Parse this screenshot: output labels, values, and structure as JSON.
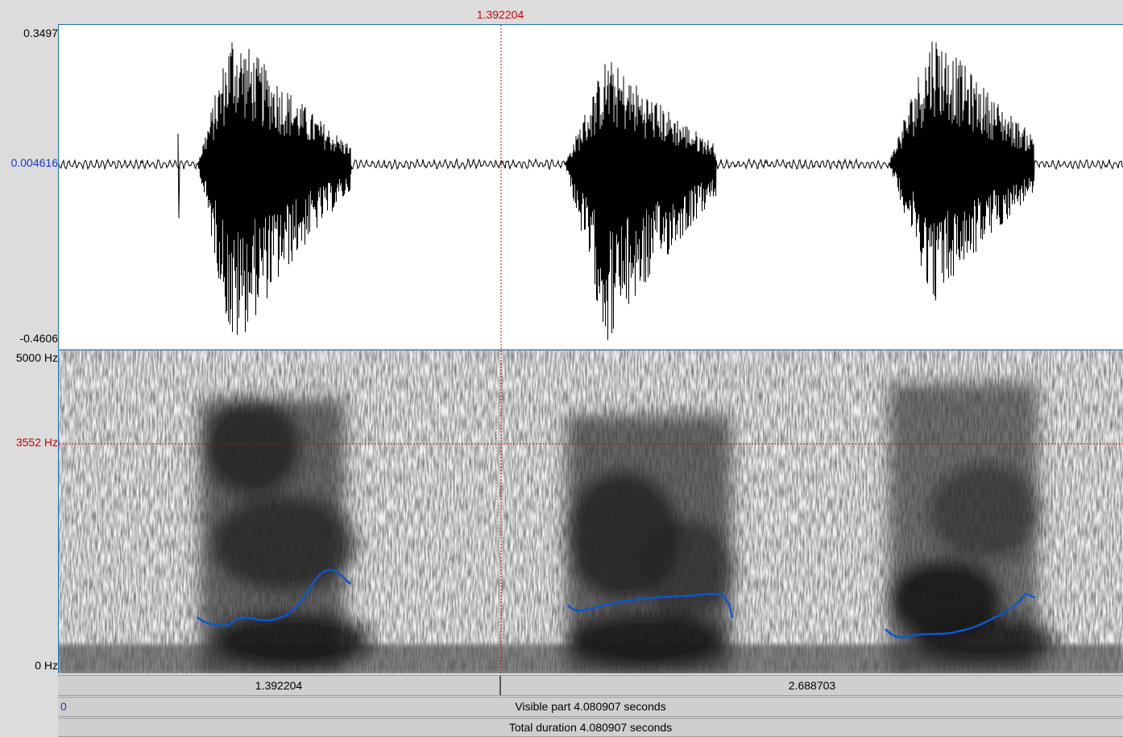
{
  "cursor": {
    "time_label": "1.392204",
    "time_seconds": 1.392204
  },
  "waveform": {
    "max_label": "0.3497",
    "mid_label": "0.004616",
    "min_label": "-0.4606",
    "color": "#000000"
  },
  "spectrogram": {
    "top_label": "5000 Hz",
    "cursor_label": "3552 Hz",
    "bottom_label": "0 Hz",
    "pitch_color": "#0b57d0"
  },
  "time_bar": {
    "left_segment": "1.392204",
    "right_segment": "2.688703"
  },
  "visible_bar": {
    "start": "0",
    "text": "Visible part 4.080907 seconds"
  },
  "total_bar": {
    "text": "Total duration 4.080907 seconds"
  },
  "colors": {
    "cursor": "#d00000",
    "frame": "#1f6fb5",
    "mid_label": "#1a36d6"
  }
}
